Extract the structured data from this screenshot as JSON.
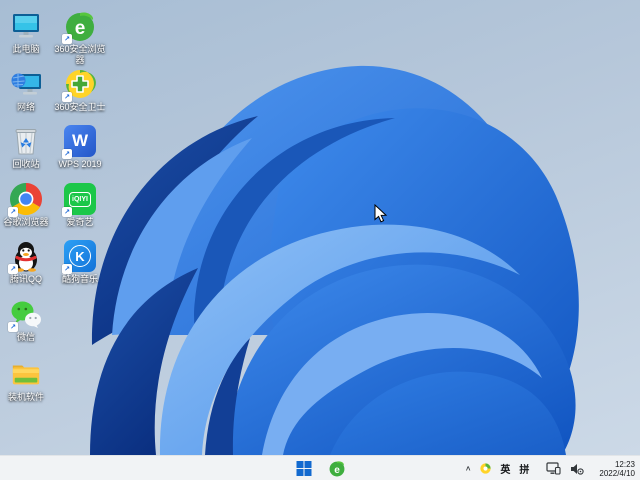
{
  "desktop": {
    "icons": [
      {
        "id": "this-pc",
        "label": "此电脑"
      },
      {
        "id": "360-browser",
        "label": "360安全浏览器",
        "glyph": "e"
      },
      {
        "id": "network",
        "label": "网络"
      },
      {
        "id": "360-safe",
        "label": "360安全卫士"
      },
      {
        "id": "recycle-bin",
        "label": "回收站"
      },
      {
        "id": "wps",
        "label": "WPS 2019",
        "glyph": "W"
      },
      {
        "id": "chrome",
        "label": "谷歌浏览器"
      },
      {
        "id": "iqiyi",
        "label": "爱奇艺",
        "glyph": "iQIYI"
      },
      {
        "id": "qq",
        "label": "腾讯QQ"
      },
      {
        "id": "kugou",
        "label": "酷狗音乐",
        "glyph": "K"
      },
      {
        "id": "wechat",
        "label": "微信"
      },
      {
        "id": "folder",
        "label": "装机软件"
      }
    ]
  },
  "taskbar": {
    "browser_glyph": "e",
    "tray": {
      "chevron": "∧",
      "lang1": "英",
      "lang2": "拼"
    },
    "clock": {
      "time": "12:23",
      "date": "2022/4/10"
    }
  },
  "colors": {
    "accent_blue": "#1f6fe0",
    "wallpaper_top": "#a7bdd4",
    "wallpaper_bottom": "#ccd9e7",
    "taskbar_bg": "#f1f3f5"
  }
}
